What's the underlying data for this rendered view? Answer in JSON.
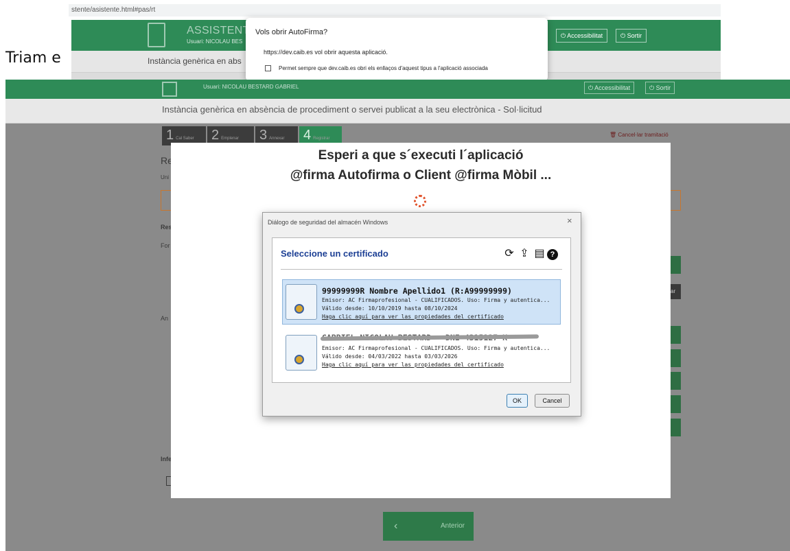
{
  "browser": {
    "url": "stente/asistente.html#pas/rt"
  },
  "top_header": {
    "title": "ASSISTENT D",
    "user": "Usuari: NICOLAU BES",
    "accessibility": "Accessibilitat",
    "logout": "Sortir",
    "instancia": "Instància genèrica en abs"
  },
  "overlay_text": {
    "triam": "Triam e"
  },
  "autofirma_dialog": {
    "title": "Vols obrir AutoFirma?",
    "message": "https://dev.caib.es vol obrir aquesta aplicació.",
    "checkbox_label": "Permet sempre que dev.caib.es obri els enllaços d'aquest tipus a l'aplicació associada"
  },
  "main_header": {
    "user": "Usuari: NICOLAU BESTARD GABRIEL",
    "accessibility": "Accessibilitat",
    "logout": "Sortir",
    "instancia": "Instància genèrica en absència de procediment o servei publicat a la seu electrònica - Sol·licitud"
  },
  "steps": [
    {
      "number": "1",
      "label": "Cal Saber"
    },
    {
      "number": "2",
      "label": "Emplenar"
    },
    {
      "number": "3",
      "label": "Annexar"
    },
    {
      "number": "4",
      "label": "Registrar"
    }
  ],
  "cancel_link": "Cancel·lar tramitació",
  "background_fragments": {
    "re": "Re",
    "un": "Uni",
    "res": "Res",
    "for": "For",
    "an": "An",
    "inf": "Infe",
    "ar": "ar"
  },
  "anterior_button": {
    "arrow": "‹",
    "label": "Anterior"
  },
  "waiting_modal": {
    "line1": "Esperi a que s´executi l´aplicació",
    "line2": "@firma Autofirma o Client @firma Mòbil ..."
  },
  "cert_dialog": {
    "title": "Diálogo de seguridad del almacén Windows",
    "close_glyph": "×",
    "heading": "Seleccione un certificado",
    "tool_icons": {
      "refresh": "⟳",
      "import": "⇪",
      "details": "▤",
      "help": "?"
    },
    "certificates": [
      {
        "name": "99999999R Nombre Apellido1 (R:A99999999)",
        "issuer": "Emisor: AC Firmaprofesional - CUALIFICADOS. Uso: Firma y autentica...",
        "valid": "Válido desde: 10/10/2019 hasta 08/10/2024",
        "link": "Haga clic aquí para ver las propiedades del certificado"
      },
      {
        "name": "GABRIEL NICOLAU BESTARD - DNI 4315127-K",
        "issuer": "Emisor: AC Firmaprofesional - CUALIFICADOS. Uso: Firma y autentica...",
        "valid": "Válido desde: 04/03/2022 hasta 03/03/2026",
        "link": "Haga clic aquí para ver las propiedades del certificado"
      }
    ],
    "ok": "OK",
    "cancel": "Cancel"
  }
}
